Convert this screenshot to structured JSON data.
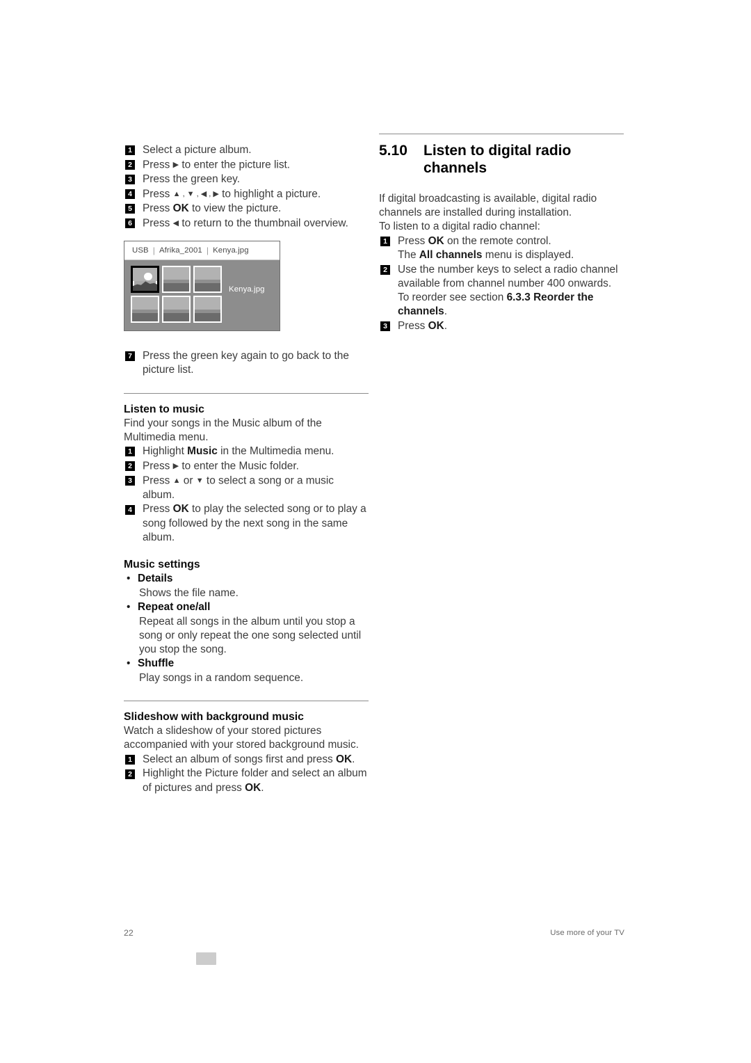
{
  "page": {
    "number": "22",
    "footer_right": "Use more of your TV"
  },
  "left_column": {
    "picture_steps": [
      {
        "num": "1",
        "text": "Select a picture album."
      },
      {
        "num": "2",
        "text_before": "Press ",
        "arrow": "▶",
        "text_after": " to enter the picture list."
      },
      {
        "num": "3",
        "text": "Press the green key."
      },
      {
        "num": "4",
        "text_before": "Press ",
        "arrows": "▲ , ▼ , ◀ , ▶",
        "text_after": " to highlight a picture."
      },
      {
        "num": "5",
        "text_before": "Press ",
        "bold": "OK",
        "text_after": " to view the picture."
      },
      {
        "num": "6",
        "text_before": "Press ",
        "arrow": "◀",
        "text_after": " to return to the thumbnail overview."
      }
    ],
    "tv_figure": {
      "breadcrumb": [
        "USB",
        "Afrika_2001",
        "Kenya.jpg"
      ],
      "separator": "|",
      "filename_label": "Kenya.jpg",
      "selected_thumbnail_index": 0,
      "thumbnail_count": 6
    },
    "step7": {
      "num": "7",
      "line1": "Press the green key again to go back to the",
      "line2": "picture list."
    },
    "listen_to_music": {
      "heading": "Listen to music",
      "intro_line1": "Find your songs in the Music album of the",
      "intro_line2": "Multimedia menu.",
      "steps": [
        {
          "num": "1",
          "before": "Highlight ",
          "bold": "Music",
          "after": " in the Multimedia menu."
        },
        {
          "num": "2",
          "before": "Press ",
          "arrow": "▶",
          "after": " to enter the Music folder."
        },
        {
          "num": "3",
          "before": "Press ",
          "arrow1": "▲",
          "mid": " or ",
          "arrow2": "▼",
          "after": " to select a song or a music",
          "after2": "album."
        },
        {
          "num": "4",
          "before": "Press ",
          "bold": "OK",
          "after": " to play the selected song or to play a",
          "after2": "song followed by the next song in the same",
          "after3": "album."
        }
      ]
    },
    "music_settings": {
      "heading": "Music settings",
      "items": [
        {
          "title": "Details",
          "desc_line1": "Shows the file name."
        },
        {
          "title": "Repeat one/all",
          "desc_line1": "Repeat all songs in the album until you stop a",
          "desc_line2": "song or only repeat the one song selected until",
          "desc_line3": "you stop the song."
        },
        {
          "title": "Shuffle",
          "desc_line1": "Play songs in a random sequence."
        }
      ]
    },
    "slideshow": {
      "heading": "Slideshow with background music",
      "intro_line1": "Watch a slideshow of your stored pictures",
      "intro_line2": "accompanied with your stored background music.",
      "steps": [
        {
          "num": "1",
          "before": "Select an album of songs first and press ",
          "bold": "OK",
          "after": "."
        },
        {
          "num": "2",
          "before": "Highlight the Picture folder and select an album",
          "line2_before": "of pictures and press ",
          "bold": "OK",
          "after": "."
        }
      ]
    }
  },
  "right_column": {
    "section_number": "5.10",
    "section_title_line1": "Listen to digital radio",
    "section_title_line2": "channels",
    "intro_line1": "If digital broadcasting is available, digital radio",
    "intro_line2": "channels are installed during installation.",
    "intro_line3": "To listen to a digital radio channel:",
    "steps": [
      {
        "num": "1",
        "before": "Press ",
        "bold": "OK",
        "after": " on the remote control.",
        "sub_before": "The ",
        "sub_bold": "All channels",
        "sub_after": " menu is displayed."
      },
      {
        "num": "2",
        "line1": "Use the number keys to select a radio channel",
        "line2": "available from channel number 400 onwards.",
        "line3_before": "To reorder see section ",
        "line3_bold": "6.3.3 Reorder the",
        "line4_bold": "channels",
        "line4_after": "."
      },
      {
        "num": "3",
        "before": "Press ",
        "bold": "OK",
        "after": "."
      }
    ]
  },
  "colors": {
    "text": "#3b3b3b",
    "heading": "#000000",
    "rule": "#8c8c8c",
    "tv_background": "#8d8d8d",
    "chip": "#cccccc"
  }
}
